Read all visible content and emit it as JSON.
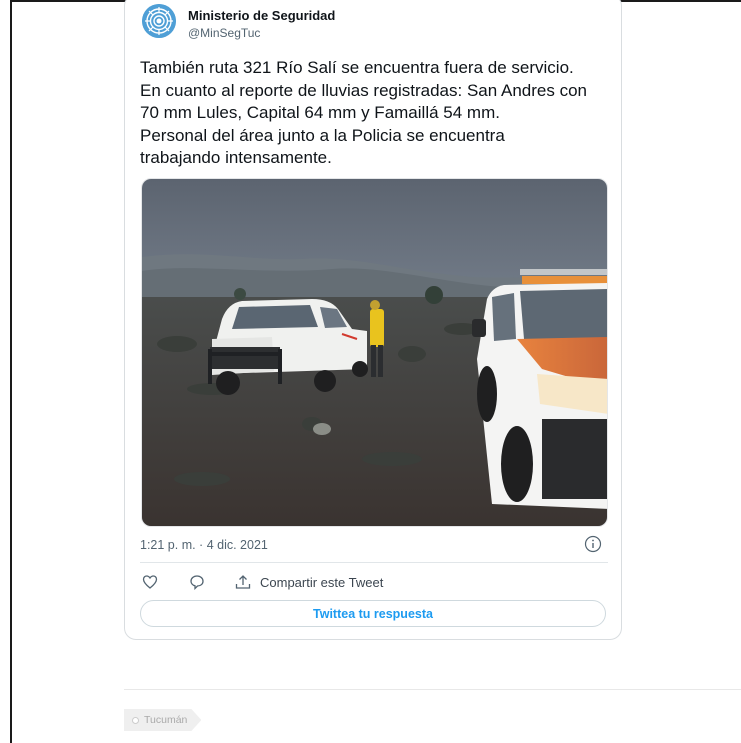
{
  "tweet": {
    "author": {
      "display_name": "Ministerio de Seguridad",
      "handle": "@MinSegTuc",
      "avatar_icon": "sun-logo"
    },
    "text_lines": [
      "También ruta 321 Río Salí se encuentra fuera de servicio.",
      "En cuanto al reporte de lluvias registradas: San Andres con",
      "70 mm Lules, Capital 64 mm y Famaillá 54 mm.",
      "Personal del área junto a la Policia se encuentra",
      "trabajando intensamente."
    ],
    "image_description": "rainy-field-with-pickup-trucks-photo",
    "timestamp": "1:21 p. m. · 4 dic. 2021",
    "actions": {
      "like_icon": "heart-icon",
      "reply_icon": "comment-icon",
      "share_icon": "share-icon",
      "share_label": "Compartir este Tweet"
    },
    "reply_button_label": "Twittea tu respuesta"
  },
  "tags": [
    "Tucumán"
  ],
  "colors": {
    "accent": "#1d9bf0",
    "secondary_text": "#536471",
    "border": "#d9dde0"
  }
}
